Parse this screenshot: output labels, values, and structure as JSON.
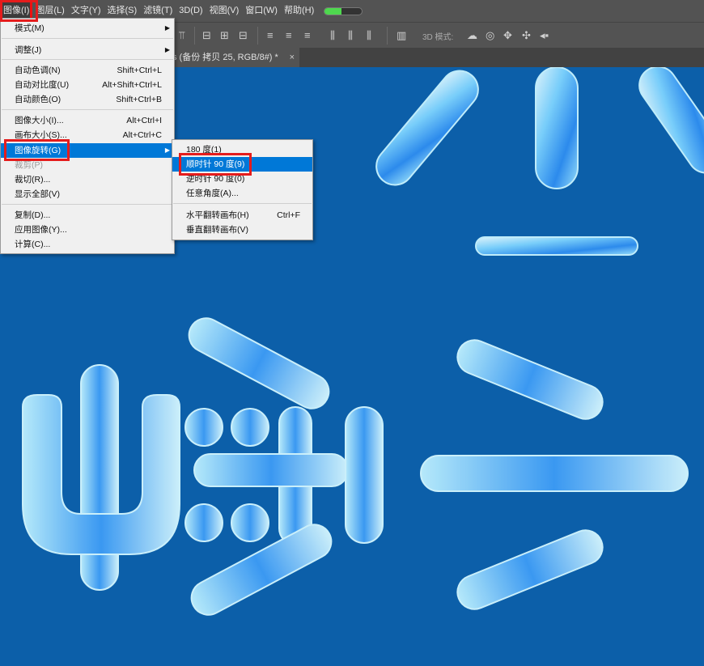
{
  "menubar": {
    "items": [
      {
        "label": "图像(I)",
        "active": true
      },
      {
        "label": "图层(L)"
      },
      {
        "label": "文字(Y)"
      },
      {
        "label": "选择(S)"
      },
      {
        "label": "滤镜(T)"
      },
      {
        "label": "3D(D)"
      },
      {
        "label": "视图(V)"
      },
      {
        "label": "窗口(W)"
      },
      {
        "label": "帮助(H)"
      }
    ],
    "progress": 0.45
  },
  "optbar": {
    "mode_label": "3D 模式:"
  },
  "document_tab": {
    "title": "s (备份 拷贝 25, RGB/8#) *",
    "close": "×"
  },
  "image_menu": {
    "items": [
      {
        "label": "模式(M)",
        "submenu": true
      },
      {
        "label": "调整(J)",
        "submenu": true
      },
      {
        "label": "自动色调(N)",
        "shortcut": "Shift+Ctrl+L"
      },
      {
        "label": "自动对比度(U)",
        "shortcut": "Alt+Shift+Ctrl+L"
      },
      {
        "label": "自动颜色(O)",
        "shortcut": "Shift+Ctrl+B"
      },
      {
        "label": "图像大小(I)...",
        "shortcut": "Alt+Ctrl+I"
      },
      {
        "label": "画布大小(S)...",
        "shortcut": "Alt+Ctrl+C"
      },
      {
        "label": "图像旋转(G)",
        "submenu": true,
        "highlighted": true
      },
      {
        "label": "裁剪(P)",
        "disabled": true
      },
      {
        "label": "裁切(R)..."
      },
      {
        "label": "显示全部(V)"
      },
      {
        "label": "复制(D)..."
      },
      {
        "label": "应用图像(Y)..."
      },
      {
        "label": "计算(C)..."
      }
    ]
  },
  "rotate_submenu": {
    "items": [
      {
        "label": "180 度(1)"
      },
      {
        "label": "顺时针 90 度(9)",
        "highlighted": true
      },
      {
        "label": "逆时针 90 度(0)"
      },
      {
        "label": "任意角度(A)..."
      },
      {
        "label": "水平翻转画布(H)",
        "shortcut": "Ctrl+F"
      },
      {
        "label": "垂直翻转画布(V)"
      }
    ]
  },
  "colors": {
    "canvas_bg": "#0c5fa9",
    "ui_dark": "#535353",
    "menu_highlight": "#0078d7",
    "annotation_red": "#e51c1c"
  },
  "icons": [
    "align-top-icon",
    "align-vcenter-icon",
    "align-bottom-icon",
    "align-left-icon",
    "align-hcenter-icon",
    "align-right-icon",
    "distribute-icon",
    "auto-align-icon",
    "orbit-3d-icon",
    "roll-3d-icon",
    "pan-3d-icon",
    "slide-3d-icon",
    "scale-3d-icon"
  ]
}
